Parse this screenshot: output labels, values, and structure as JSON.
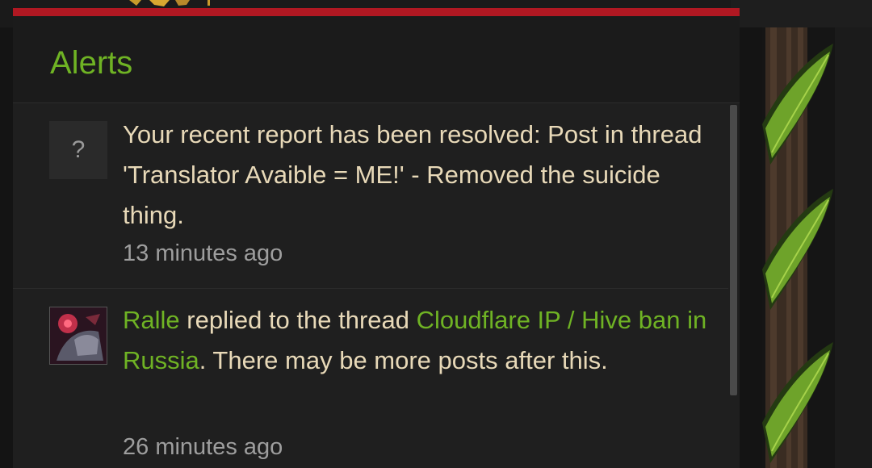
{
  "alerts_panel": {
    "title": "Alerts",
    "accent_color": "#b01822",
    "title_color": "#6fb324"
  },
  "alerts": [
    {
      "icon": "question-mark-icon",
      "icon_glyph": "?",
      "message": "Your recent report has been resolved: Post in thread 'Translator Avaible = ME!' - Removed the suicide thing.",
      "time": "13 minutes ago"
    },
    {
      "icon": "user-avatar",
      "user": "Ralle",
      "action_text": " replied to the thread ",
      "thread_title": "Cloudflare IP / Hive ban in Russia",
      "suffix_text": ". There may be more posts after this.",
      "time": "26 minutes ago"
    }
  ]
}
